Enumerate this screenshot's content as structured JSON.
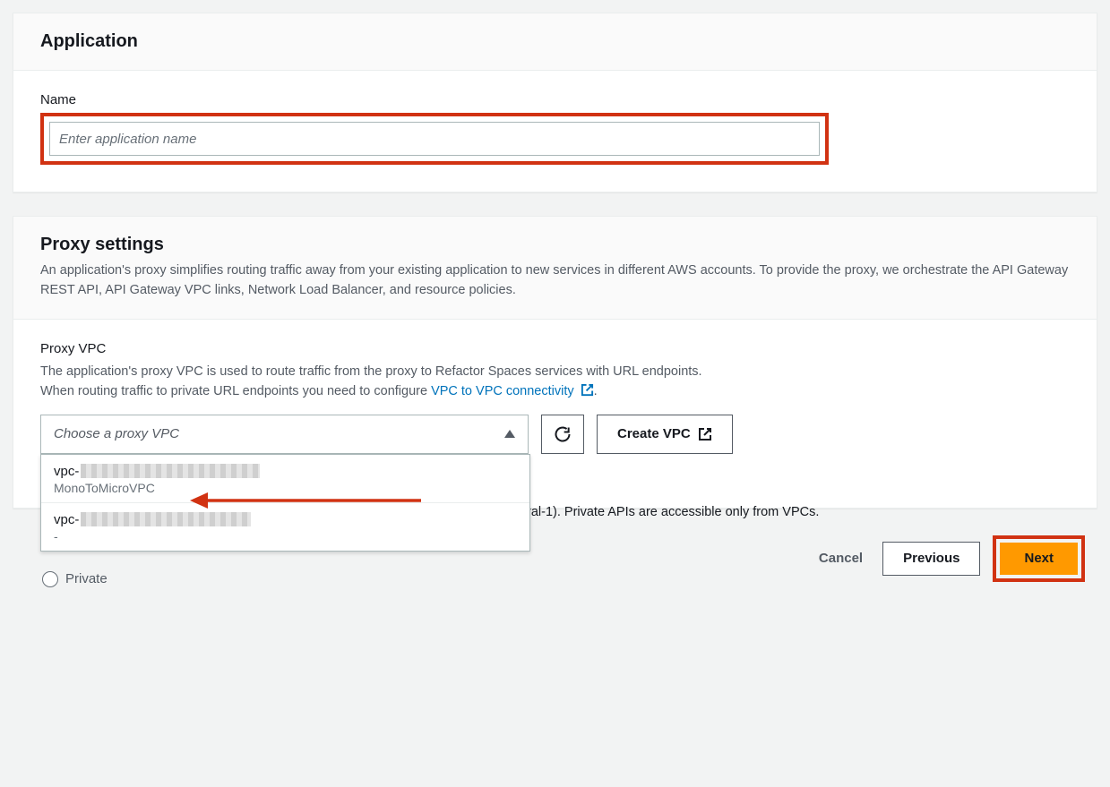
{
  "application_panel": {
    "title": "Application",
    "name_label": "Name",
    "name_placeholder": "Enter application name",
    "name_value": ""
  },
  "proxy_panel": {
    "title": "Proxy settings",
    "description": "An application's proxy simplifies routing traffic away from your existing application to new services in different AWS accounts. To provide the proxy, we orchestrate the API Gateway REST API, API Gateway VPC links, Network Load Balancer, and resource policies.",
    "proxy_vpc_label": "Proxy VPC",
    "proxy_vpc_help_line1": "The application's proxy VPC is used to route traffic from the proxy to Refactor Spaces services with URL endpoints.",
    "proxy_vpc_help_line2_prefix": "When routing traffic to private URL endpoints you need to configure ",
    "proxy_vpc_link_text": "VPC to VPC connectivity",
    "proxy_vpc_help_line2_suffix": ".",
    "select_placeholder": "Choose a proxy VPC",
    "create_vpc_label": "Create VPC",
    "region_hint_fragment": "ral-1). Private APIs are accessible only from VPCs.",
    "private_label": "Private",
    "dropdown": {
      "options": [
        {
          "id_prefix": "vpc-",
          "id_redacted": true,
          "name": "MonoToMicroVPC"
        },
        {
          "id_prefix": "vpc-",
          "id_redacted": true,
          "name": "-"
        }
      ]
    }
  },
  "footer": {
    "cancel": "Cancel",
    "previous": "Previous",
    "next": "Next"
  },
  "colors": {
    "highlight_red": "#d13212",
    "primary_orange": "#ff9900",
    "link_blue": "#0073bb"
  }
}
